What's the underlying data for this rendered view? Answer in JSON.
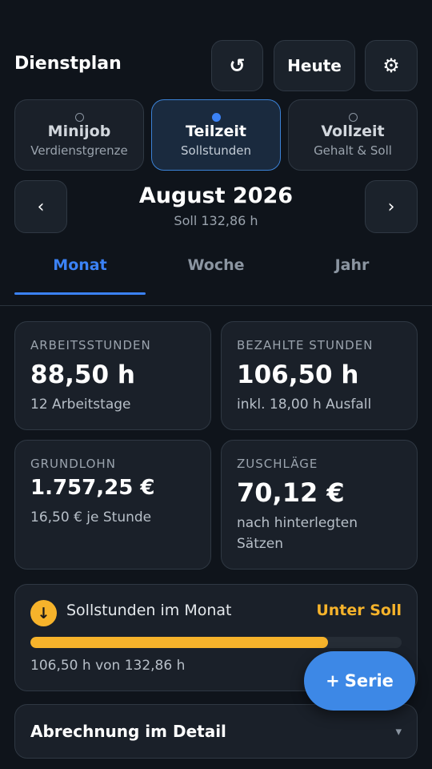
{
  "header": {
    "title": "Dienstplan",
    "reset_icon": "refresh-icon",
    "reset_glyph": "↺",
    "today_label": "Heute",
    "settings_icon": "gear-icon",
    "settings_glyph": "⚙"
  },
  "modes": [
    {
      "label": "Minijob",
      "sub": "Verdienstgrenze",
      "selected": false
    },
    {
      "label": "Teilzeit",
      "sub": "Sollstunden",
      "selected": true
    },
    {
      "label": "Vollzeit",
      "sub": "Gehalt & Soll",
      "selected": false
    }
  ],
  "month": {
    "title": "August 2026",
    "subtitle": "Soll 132,86 h",
    "prev_glyph": "‹",
    "next_glyph": "›"
  },
  "tabs": [
    {
      "label": "Monat",
      "active": true
    },
    {
      "label": "Woche",
      "active": false
    },
    {
      "label": "Jahr",
      "active": false
    }
  ],
  "stats": [
    {
      "label": "ARBEITSSTUNDEN",
      "value": "88,50 h",
      "sub": "12 Arbeitstage"
    },
    {
      "label": "BEZAHLTE STUNDEN",
      "value": "106,50 h",
      "sub": "inkl. 18,00 h Ausfall"
    },
    {
      "label": "GRUNDLOHN",
      "value": "1.757,25 €",
      "sub": "16,50 € je Stunde"
    },
    {
      "label": "ZUSCHLÄGE",
      "value": "70,12 €",
      "sub": "nach hinterlegten Sätzen"
    }
  ],
  "target": {
    "icon": "arrow-down-icon",
    "icon_glyph": "↓",
    "title": "Sollstunden im Monat",
    "status": "Unter Soll",
    "progress": 0.8016,
    "summary": "106,50 h von 132,86 h",
    "colors": {
      "accent": "#f6b32b"
    }
  },
  "fab": {
    "plus_glyph": "+",
    "label": "Serie"
  },
  "detail": {
    "title": "Abrechnung im Detail",
    "chevron_glyph": "▾"
  },
  "colors": {
    "background": "#0f141b",
    "primary": "#3b82f6",
    "warning": "#f6b32b"
  }
}
